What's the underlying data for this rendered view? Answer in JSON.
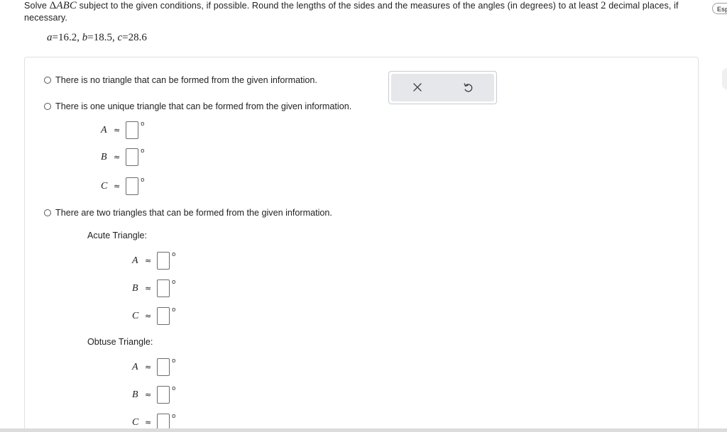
{
  "question": {
    "verb": "Solve ",
    "triangle_symbol": "Δ",
    "triangle_name": "ABC",
    "rest_before_num": " subject to the given conditions, if possible. Round the lengths of the sides and the measures of the angles (in degrees) to at least ",
    "round_places": "2",
    "rest_after_num": " decimal places, if necessary."
  },
  "given": {
    "a_var": "a",
    "a_val": "16.2",
    "b_var": "b",
    "b_val": "18.5",
    "c_var": "c",
    "c_val": "28.6"
  },
  "language_button": "Esp",
  "options": {
    "none": "There is no triangle that can be formed from the given information.",
    "one": "There is one unique triangle that can be formed from the given information.",
    "two": "There are two triangles that can be formed from the given information."
  },
  "vars": {
    "A": "A",
    "B": "B",
    "C": "C"
  },
  "symbols": {
    "approx": "≈",
    "degree": "o"
  },
  "sub_labels": {
    "acute": "Acute Triangle:",
    "obtuse": "Obtuse Triangle:"
  },
  "toolbar": {
    "clear_icon": "x-icon",
    "undo_icon": "undo-icon"
  }
}
